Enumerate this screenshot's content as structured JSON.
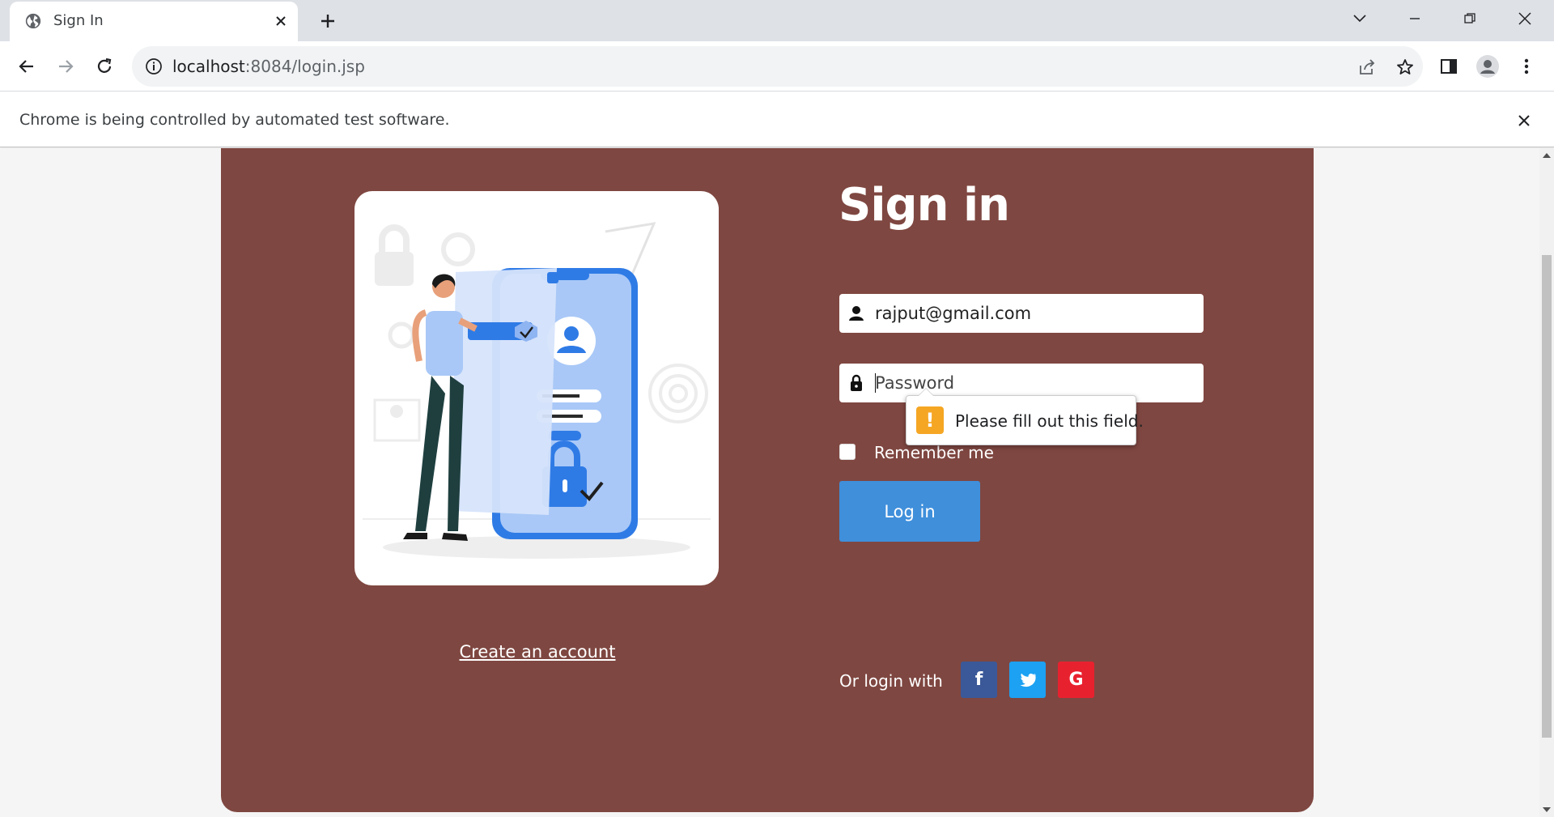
{
  "browser": {
    "tab_title": "Sign In",
    "url_host": "localhost",
    "url_rest": ":8084/login.jsp",
    "infobar_message": "Chrome is being controlled by automated test software."
  },
  "page": {
    "title": "Sign in",
    "email_value": "rajput@gmail.com",
    "password_placeholder": "Password",
    "remember_label": "Remember me",
    "tooltip_text": "Please fill out this field.",
    "login_button": "Log in",
    "create_account": "Create an account",
    "social_label": "Or login with",
    "social_icons": [
      "facebook-icon",
      "twitter-icon",
      "google-icon"
    ]
  },
  "colors": {
    "card_bg": "#7f4741",
    "login_button": "#3f8fdb",
    "facebook": "#3b5998",
    "twitter": "#1da1f2",
    "google": "#e8212f",
    "warning": "#f5a623"
  }
}
